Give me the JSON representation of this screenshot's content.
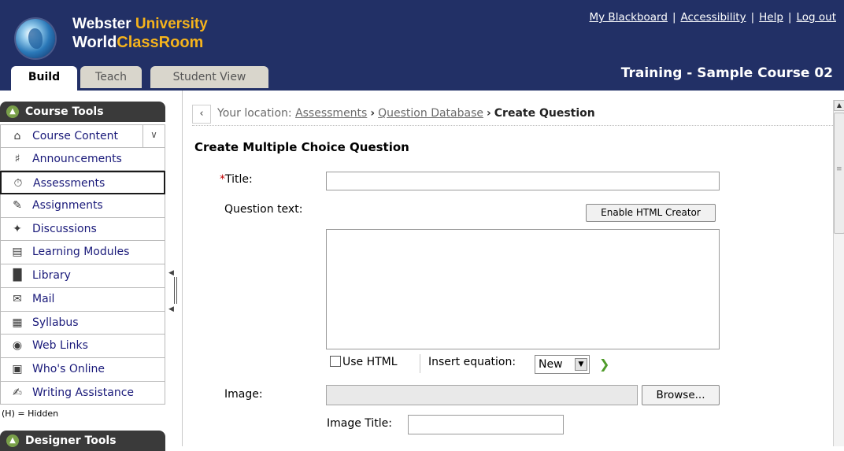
{
  "header": {
    "brand_line1_a": "Webster ",
    "brand_line1_b": "University",
    "brand_line2_a": "World",
    "brand_line2_b": "ClassRoom",
    "links": [
      "My Blackboard",
      "Accessibility",
      "Help",
      "Log out"
    ],
    "link_separator": "|",
    "course_title": "Training - Sample Course 02",
    "background_color": "#223066",
    "accent_color": "#f5b31c"
  },
  "tabs": [
    {
      "label": "Build",
      "active": true
    },
    {
      "label": "Teach",
      "active": false
    },
    {
      "label": "Student View",
      "active": false
    }
  ],
  "sidebar": {
    "title": "Course Tools",
    "items": [
      {
        "label": "Course Content",
        "icon": "home-icon"
      },
      {
        "label": "Announcements",
        "icon": "megaphone-icon"
      },
      {
        "label": "Assessments",
        "icon": "stopwatch-icon",
        "active": true
      },
      {
        "label": "Assignments",
        "icon": "pencil-paper-icon"
      },
      {
        "label": "Discussions",
        "icon": "pushpin-icon"
      },
      {
        "label": "Learning Modules",
        "icon": "document-stack-icon"
      },
      {
        "label": "Library",
        "icon": "books-icon"
      },
      {
        "label": "Mail",
        "icon": "envelope-icon"
      },
      {
        "label": "Syllabus",
        "icon": "syllabus-icon"
      },
      {
        "label": "Web Links",
        "icon": "globe-icon"
      },
      {
        "label": "Who's Online",
        "icon": "person-icon"
      },
      {
        "label": "Writing Assistance",
        "icon": "writing-icon"
      }
    ],
    "hidden_note": "(H) = Hidden",
    "designer_title": "Designer Tools"
  },
  "breadcrumb": {
    "prefix": "Your location: ",
    "links": [
      "Assessments",
      "Question Database"
    ],
    "current": "Create Question",
    "separator": "›"
  },
  "form": {
    "heading": "Create Multiple Choice Question",
    "title_label": "Title:",
    "required_marker": "*",
    "title_value": "",
    "question_text_label": "Question text:",
    "enable_html_creator": "Enable HTML Creator",
    "use_html_label": "Use HTML",
    "use_html_checked": false,
    "insert_equation_label": "Insert equation:",
    "equation_option": "New",
    "image_label": "Image:",
    "browse_label": "Browse...",
    "image_title_label": "Image Title:",
    "image_title_value": ""
  }
}
